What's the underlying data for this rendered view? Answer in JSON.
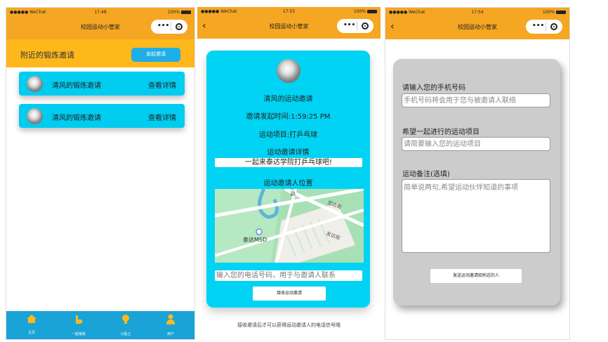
{
  "common": {
    "carrier": "●●●●● WeChat",
    "battery": "100%",
    "app_title": "校园运动小管家"
  },
  "screen1": {
    "time": "17:48",
    "section_label": "附近的锻炼邀请",
    "create_button": "发起邀请",
    "cards": [
      {
        "name": "清风的锻炼邀请",
        "detail": "查看详情"
      },
      {
        "name": "清风的锻炼邀请",
        "detail": "查看详情"
      }
    ],
    "tabs": [
      {
        "label": "主页",
        "icon": "home-icon"
      },
      {
        "label": "一起锻炼",
        "icon": "muscle-icon"
      },
      {
        "label": "小贴士",
        "icon": "lightbulb-icon"
      },
      {
        "label": "用户",
        "icon": "user-icon"
      }
    ]
  },
  "screen2": {
    "time": "17:55",
    "invite_title": "清风的运动邀请",
    "invite_time": "邀请发起时间:1:59:25 PM",
    "sport": "运动项目:打乒乓球",
    "detail_label": "运动邀请详情",
    "detail_text": "一起来泰达学院打乒乓球吧!",
    "location_label": "运动邀请人位置",
    "map_labels": {
      "road1": "路",
      "road2": "宏达街",
      "road3": "发达街",
      "place": "泰达MSD"
    },
    "phone_placeholder": "输入您的电话号码，用于与邀请人联系",
    "accept_button": "接收运动邀请",
    "footnote": "接收邀请后才可以获得运动邀请人的电话信号哦"
  },
  "screen3": {
    "time": "17:54",
    "phone_label": "请输入您的手机号码",
    "phone_placeholder": "手机号码将会用于您与被邀请人联络",
    "sport_label": "希望一起进行的运动项目",
    "sport_placeholder": "请简要输入您的运动项目",
    "remark_label": "运动备注(选填)",
    "remark_placeholder": "简单说两句,希望运动伙伴知道的事项",
    "send_button": "发送运动邀请给附近的人"
  }
}
